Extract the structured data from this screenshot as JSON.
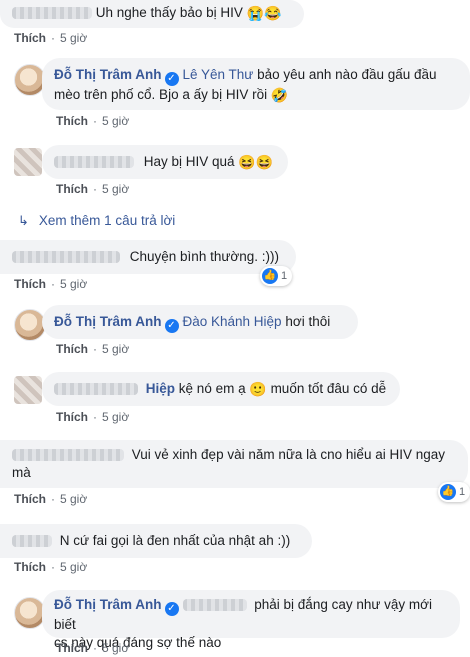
{
  "comments": [
    {
      "text": "Uh nghe thấy bảo bị HIV",
      "emoji": "😭😂",
      "like": "Thích",
      "time": "5 giờ"
    },
    {
      "author": "Đỗ Thị Trâm Anh",
      "mention": "Lê Yên Thư",
      "text_line1": "bảo yêu anh nào đầu gấu đầu",
      "text_line2": "mèo trên phố cổ. Bjo a ấy bị HIV rồi",
      "emoji": "🤣",
      "like": "Thích",
      "time": "5 giờ"
    },
    {
      "text": "Hay bị HIV quá",
      "emoji": "😆😆",
      "like": "Thích",
      "time": "5 giờ"
    },
    {
      "text": "Chuyện bình thường. :)))",
      "like": "Thích",
      "time": "5 giờ",
      "reaction_count": "1"
    },
    {
      "author": "Đỗ Thị Trâm Anh",
      "mention": "Đào Khánh Hiệp",
      "text": "hơi thôi",
      "like": "Thích",
      "time": "5 giờ"
    },
    {
      "mention": "Hiệp",
      "text_a": "kệ nó em ạ",
      "emoji": "🙂",
      "text_b": "muốn tốt đâu có dễ",
      "like": "Thích",
      "time": "5 giờ"
    },
    {
      "text_line1": "Vui vẻ xinh đẹp vài năm nữa là cno hiểu ai HIV ngay",
      "text_line2": "mà",
      "like": "Thích",
      "time": "5 giờ",
      "reaction_count": "1"
    },
    {
      "text": "N cứ fai gọi là đen nhất của nhật ah :))",
      "like": "Thích",
      "time": "5 giờ"
    },
    {
      "author": "Đỗ Thị Trâm Anh",
      "text_line1": "phải bị đắng cay như vậy mới biết",
      "text_line2": "cs này quá đáng sợ thế nào",
      "like": "Thích",
      "time": "5 giờ"
    }
  ],
  "view_more": {
    "label": "Xem thêm 1 câu trả lời"
  },
  "separator": "·",
  "verified_glyph": "✓",
  "like_glyph": "👍"
}
